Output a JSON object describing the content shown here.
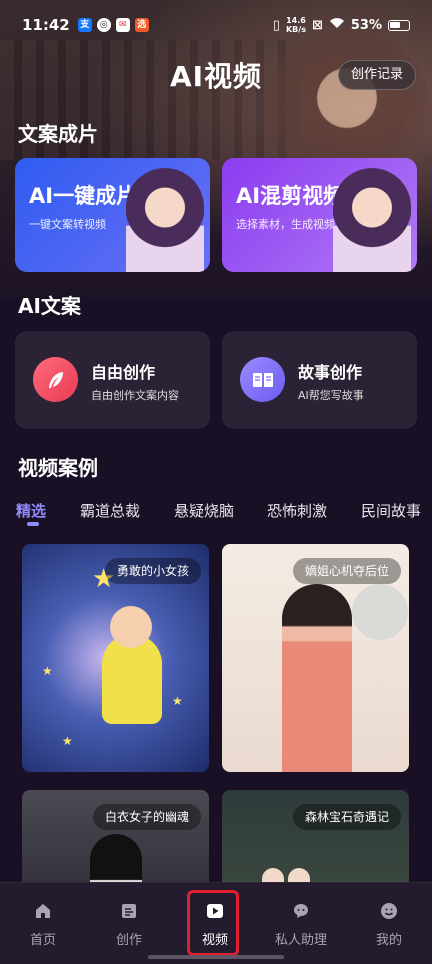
{
  "status_bar": {
    "time": "11:42",
    "speed_value": "14.6",
    "speed_unit": "KB/s",
    "battery": "53%"
  },
  "header": {
    "title": "AI视频",
    "records_button": "创作记录"
  },
  "section_copy_to_video": {
    "title": "文案成片",
    "cards": [
      {
        "title": "AI一键成片",
        "subtitle": "一键文案转视频"
      },
      {
        "title": "AI混剪视频",
        "subtitle": "选择素材，生成视频"
      }
    ]
  },
  "section_ai_copy": {
    "title": "AI文案",
    "cards": [
      {
        "title": "自由创作",
        "subtitle": "自由创作文案内容",
        "icon": "feather-icon"
      },
      {
        "title": "故事创作",
        "subtitle": "AI帮您写故事",
        "icon": "book-icon"
      }
    ]
  },
  "section_cases": {
    "title": "视频案例",
    "tabs": [
      "精选",
      "霸道总裁",
      "悬疑烧脑",
      "恐怖刺激",
      "民间故事"
    ],
    "active_tab": "精选",
    "tiles": [
      {
        "label": "勇敢的小女孩"
      },
      {
        "label": "嫡姐心机夺后位"
      },
      {
        "label": "白衣女子的幽魂"
      },
      {
        "label": "森林宝石奇遇记"
      }
    ]
  },
  "bottom_nav": {
    "items": [
      {
        "label": "首页",
        "icon": "home-icon"
      },
      {
        "label": "创作",
        "icon": "edit-icon"
      },
      {
        "label": "视频",
        "icon": "play-icon"
      },
      {
        "label": "私人助理",
        "icon": "chat-icon"
      },
      {
        "label": "我的",
        "icon": "profile-icon"
      }
    ],
    "active": "视频"
  },
  "colors": {
    "background": "#1a1025",
    "accent": "#8f8af7",
    "card_blue": "#2f5cf0",
    "card_purple": "#8b3cf0",
    "highlight_red": "#e0202a"
  }
}
